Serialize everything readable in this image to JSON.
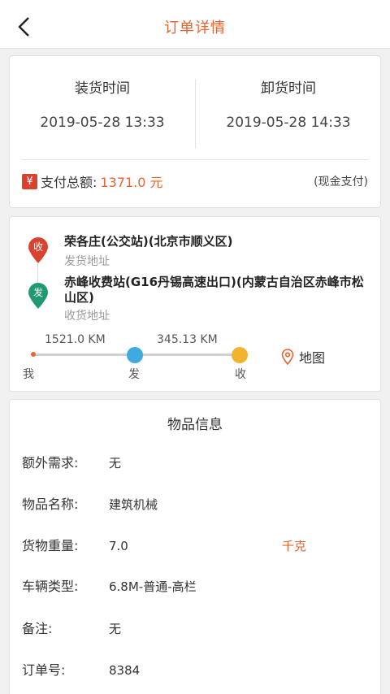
{
  "header": {
    "title": "订单详情"
  },
  "times": {
    "load_label": "装货时间",
    "load_value": "2019-05-28 13:33",
    "unload_label": "卸货时间",
    "unload_value": "2019-05-28 14:33"
  },
  "payment": {
    "icon_glyph": "¥",
    "label": "支付总额:",
    "amount": "1371.0 元",
    "method": "(现金支付)"
  },
  "route": {
    "receive": {
      "pin_text": "收",
      "pin_color": "#d9422e",
      "address": "荣各庄(公交站)(北京市顺义区)",
      "sub": "发货地址"
    },
    "send": {
      "pin_text": "发",
      "pin_color": "#1f9a6e",
      "address": "赤峰收费站(G16丹锡高速出口)(内蒙古自治区赤峰市松山区)",
      "sub": "收货地址"
    },
    "distance_1": "1521.0 KM",
    "distance_2": "345.13 KM",
    "point_me": "我",
    "point_fa": "发",
    "point_shou": "收",
    "map_label": "地图"
  },
  "goods": {
    "title": "物品信息",
    "rows": [
      {
        "label": "额外需求:",
        "value": "无"
      },
      {
        "label": "物品名称:",
        "value": "建筑机械"
      },
      {
        "label": "货物重量:",
        "value": "7.0",
        "unit": "千克"
      },
      {
        "label": "车辆类型:",
        "value": "6.8M-普通-高栏"
      },
      {
        "label": "备注:",
        "value": "无"
      },
      {
        "label": "订单号:",
        "value": "8384"
      }
    ]
  },
  "colors": {
    "accent": "#e8632f"
  }
}
